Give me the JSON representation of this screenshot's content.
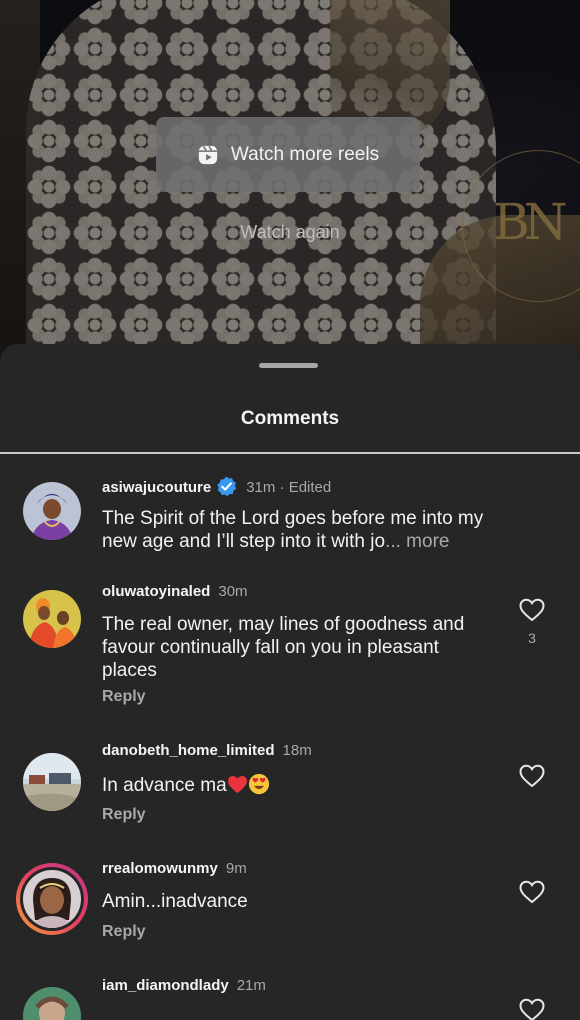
{
  "video": {
    "watch_more_label": "Watch more reels",
    "watch_again_label": "Watch again",
    "monogram": "BN",
    "icons": {
      "reels": "reels-icon"
    }
  },
  "sheet": {
    "title": "Comments"
  },
  "comments": [
    {
      "username": "asiwajucouture",
      "verified": true,
      "time": "31m · Edited",
      "text": "The Spirit of the Lord goes before me into my new age and I’ll step into it with jo",
      "more": "... more"
    },
    {
      "username": "oluwatoyinaled",
      "time": "30m",
      "text": "The real owner, may lines of goodness and favour continually fall on you in pleasant places",
      "reply": "Reply",
      "likes": "3"
    },
    {
      "username": "danobeth_home_limited",
      "time": "18m",
      "text": "In advance ma",
      "reply": "Reply",
      "emojis": [
        "red-heart",
        "heart-eyes-face"
      ]
    },
    {
      "username": "rrealomowunmy",
      "time": "9m",
      "text": "Amin...inadvance",
      "reply": "Reply"
    },
    {
      "username": "iam_diamondlady",
      "time": "21m"
    }
  ],
  "colors": {
    "sheet_bg": "#262626",
    "verified_blue": "#3897f0",
    "story_ring_start": "#f9a13a",
    "story_ring_end": "#c1358c"
  }
}
